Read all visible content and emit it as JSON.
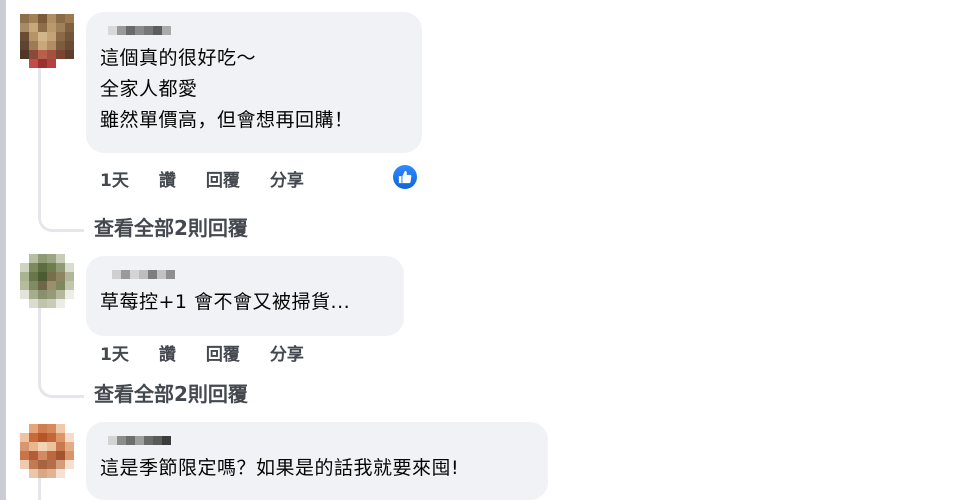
{
  "comments": [
    {
      "text_lines": [
        "這個真的很好吃～",
        "全家人都愛",
        "雖然單價高，但會想再回購！"
      ],
      "time": "1天",
      "like": "讚",
      "reply": "回覆",
      "share": "分享",
      "view_replies": "查看全部2則回覆"
    },
    {
      "text_lines": [
        "草莓控+1 會不會又被掃貨..."
      ],
      "time": "1天",
      "like": "讚",
      "reply": "回覆",
      "share": "分享",
      "view_replies": "查看全部2則回覆"
    },
    {
      "text_lines": [
        "這是季節限定嗎？如果是的話我就要來囤!"
      ]
    }
  ],
  "icons": {
    "reaction": "like-icon"
  },
  "colors": {
    "bubble": "#f0f2f5",
    "like_blue": "#1877f2",
    "meta_text": "#444950"
  }
}
